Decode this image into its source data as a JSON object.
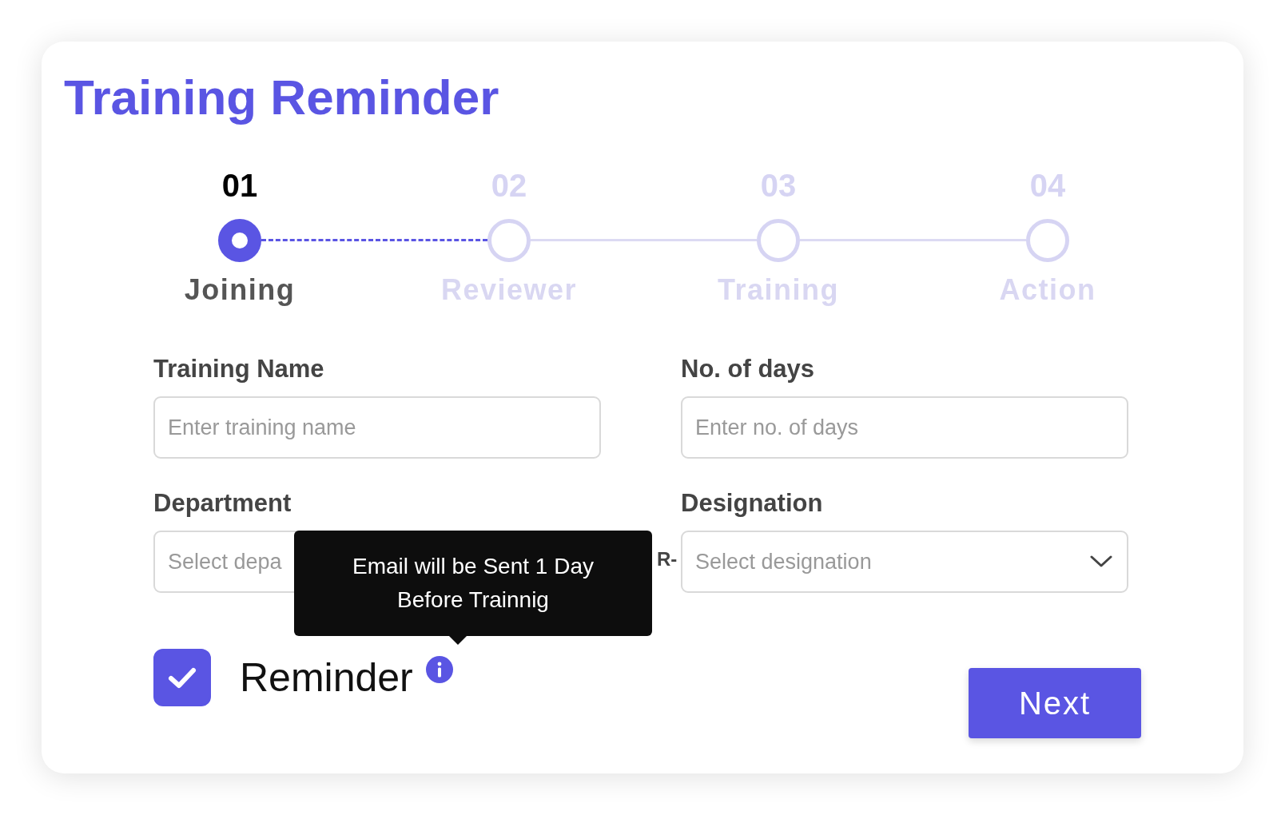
{
  "title": "Training Reminder",
  "steps": [
    {
      "number": "01",
      "label": "Joining",
      "selected": true
    },
    {
      "number": "02",
      "label": "Reviewer",
      "selected": false
    },
    {
      "number": "03",
      "label": "Training",
      "selected": false
    },
    {
      "number": "04",
      "label": "Action",
      "selected": false
    }
  ],
  "fields": [
    {
      "label": "Training Name",
      "placeholder": "Enter training name",
      "kind": "text"
    },
    {
      "label": "No. of days",
      "placeholder": "Enter no. of days",
      "kind": "text"
    },
    {
      "label": "Department",
      "placeholder": "Select depa",
      "kind": "select",
      "trailing_text": "R-"
    },
    {
      "label": "Designation",
      "placeholder": "Select designation",
      "kind": "select"
    }
  ],
  "tooltip": {
    "lines": [
      "Email will be Sent 1 Day",
      "Before Trainnig"
    ]
  },
  "reminder": {
    "label": "Reminder",
    "checked": true
  },
  "next_button": "Next"
}
